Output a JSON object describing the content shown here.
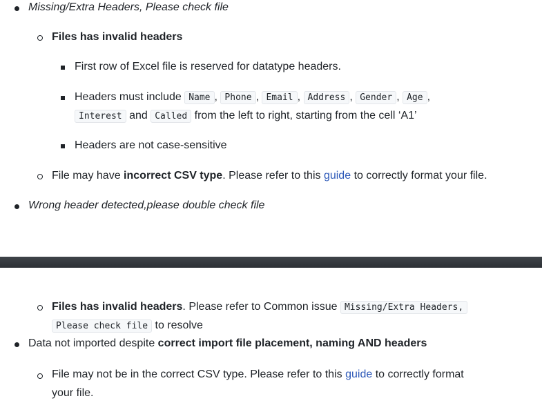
{
  "top": {
    "item1": "Missing/Extra Headers, Please check file",
    "sub1_title": "Files has invalid headers",
    "sub1_points": {
      "p1": "First row of Excel file is reserved for datatype headers.",
      "p2_prefix": "Headers must include",
      "p2_codes": [
        "Name",
        "Phone",
        "Email",
        "Address",
        "Gender",
        "Age",
        "Interest",
        "Called"
      ],
      "comma": ",",
      "and": "and",
      "p2_suffix": "from the left to right, starting from the cell ‘A1’",
      "p3": "Headers are not case-sensitive"
    },
    "sub2": {
      "prefix": "File may have",
      "bold": "incorrect CSV type",
      "mid": ". Please refer to this",
      "link": "guide",
      "suffix": "to correctly format your file."
    },
    "item2": "Wrong header detected,please double check file"
  },
  "bottom": {
    "sub1": {
      "bold": "Files has invalid headers",
      "text": ". Please refer to Common issue",
      "code_line1": "Missing/Extra Headers,",
      "code_line2": "Please check file",
      "suffix": "to resolve"
    },
    "item": {
      "prefix": "Data not imported despite",
      "bold": "correct import file placement, naming AND headers"
    },
    "sub2": {
      "prefix": "File may not be in the correct CSV type. Please refer to this",
      "link": "guide",
      "suffix": "to correctly format",
      "line2": "your file."
    }
  }
}
